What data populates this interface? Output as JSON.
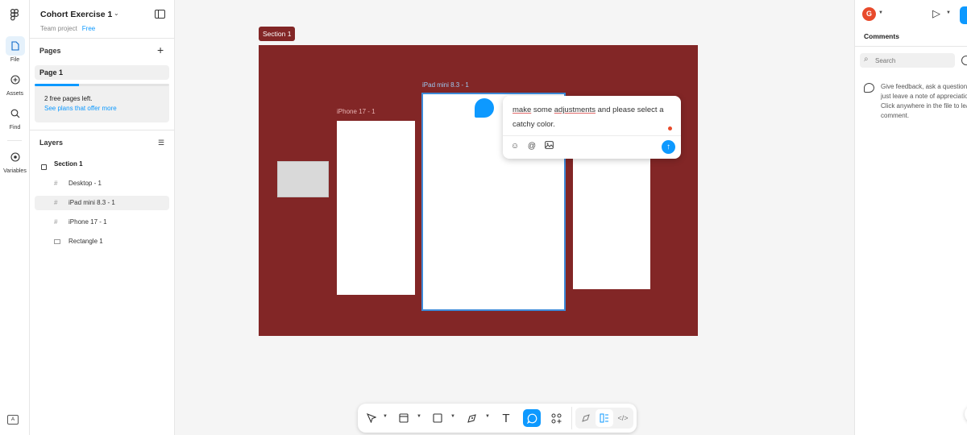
{
  "rail": {
    "items": [
      {
        "label": "File",
        "icon": "file-icon"
      },
      {
        "label": "Assets",
        "icon": "assets-icon"
      },
      {
        "label": "Find",
        "icon": "search-icon"
      },
      {
        "label": "Variables",
        "icon": "variables-icon"
      }
    ]
  },
  "file": {
    "title": "Cohort Exercise 1",
    "project": "Team project",
    "plan": "Free"
  },
  "pages": {
    "title": "Pages",
    "items": [
      {
        "label": "Page 1"
      }
    ],
    "free_left_text": "2 free pages left.",
    "see_plans_link": "See plans that offer more",
    "usage_fraction": 0.33
  },
  "layers": {
    "title": "Layers",
    "items": [
      {
        "label": "Section 1"
      },
      {
        "label": "Desktop - 1"
      },
      {
        "label": "iPad mini 8.3 - 1"
      },
      {
        "label": "iPhone 17 - 1"
      },
      {
        "label": "Rectangle 1"
      }
    ]
  },
  "canvas": {
    "section_label": "Section 1",
    "frames": {
      "ipad": "iPad mini 8.3 - 1",
      "iphone": "iPhone 17 - 1"
    },
    "section_color": "#822626"
  },
  "comment": {
    "text_1": "make",
    "text_2": " some ",
    "text_3": "adjustments",
    "text_4": " and please select a catchy color."
  },
  "right": {
    "avatar_letter": "G",
    "title": "Comments",
    "search_placeholder": "Search",
    "hint": "Give feedback, ask a question, or just leave a note of appreciation. Click anywhere in the file to leave a comment."
  },
  "colors": {
    "accent": "#0d99ff",
    "avatar": "#e84a2b"
  }
}
